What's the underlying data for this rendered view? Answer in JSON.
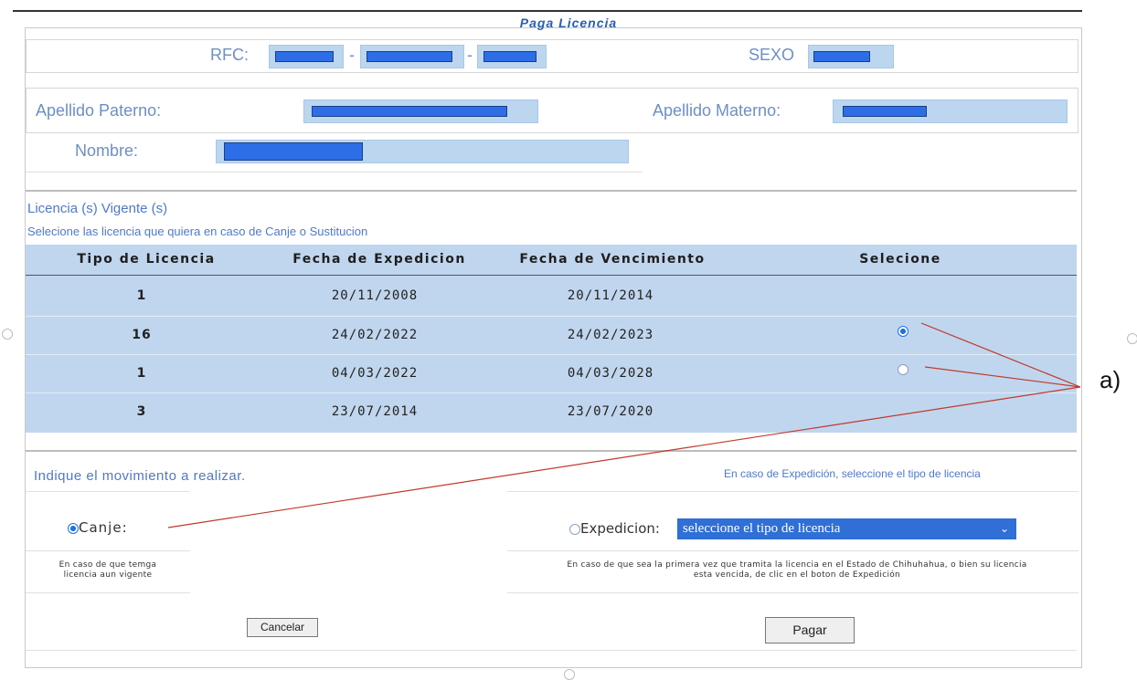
{
  "title": "Paga Licencia",
  "personal": {
    "rfc_label": "RFC:",
    "rfc_sep": "-",
    "sexo_label": "SEXO",
    "apellido_paterno_label": "Apellido Paterno:",
    "apellido_materno_label": "Apellido Materno:",
    "nombre_label": "Nombre:"
  },
  "licencias": {
    "title": "Licencia (s) Vigente (s)",
    "subtitle": "Selecione las licencia que quiera en caso de Canje o Sustitucion",
    "headers": [
      "Tipo de Licencia",
      "Fecha de Expedicion",
      "Fecha de Vencimiento",
      "Selecione"
    ],
    "rows": [
      {
        "tipo": "1",
        "expedicion": "20/11/2008",
        "vencimiento": "20/11/2014",
        "selected": null
      },
      {
        "tipo": "16",
        "expedicion": "24/02/2022",
        "vencimiento": "24/02/2023",
        "selected": true
      },
      {
        "tipo": "1",
        "expedicion": "04/03/2022",
        "vencimiento": "04/03/2028",
        "selected": false
      },
      {
        "tipo": "3",
        "expedicion": "23/07/2014",
        "vencimiento": "23/07/2020",
        "selected": null
      }
    ]
  },
  "movimiento": {
    "label": "Indique el movimiento a realizar.",
    "expedicion_hint": "En caso de Expedición, seleccione el tipo de licencia",
    "canje_label": "Canje:",
    "canje_selected": true,
    "expedicion_label": "Expedicion:",
    "expedicion_selected": false,
    "select_value": "seleccione el tipo de licencia",
    "canje_note_1": "En caso de que temga",
    "canje_note_2": "licencia aun vigente",
    "expedicion_note_1": "En caso de que sea la primera vez que tramita la licencia en el Estado de Chihuhahua, o bien su licencia",
    "expedicion_note_2": "esta vencida, de clic en el boton de Expedición"
  },
  "buttons": {
    "cancelar": "Cancelar",
    "pagar": "Pagar"
  },
  "annotation": {
    "label": "a)"
  },
  "colors": {
    "accent_text": "#4f79c8",
    "table_bg": "#c0d6ee",
    "field_bg": "#bcd6ef",
    "redaction": "#2d6ee6",
    "annotation_line": "#c0392b"
  },
  "icons": {
    "select_arrow": "chevron-down-icon"
  }
}
